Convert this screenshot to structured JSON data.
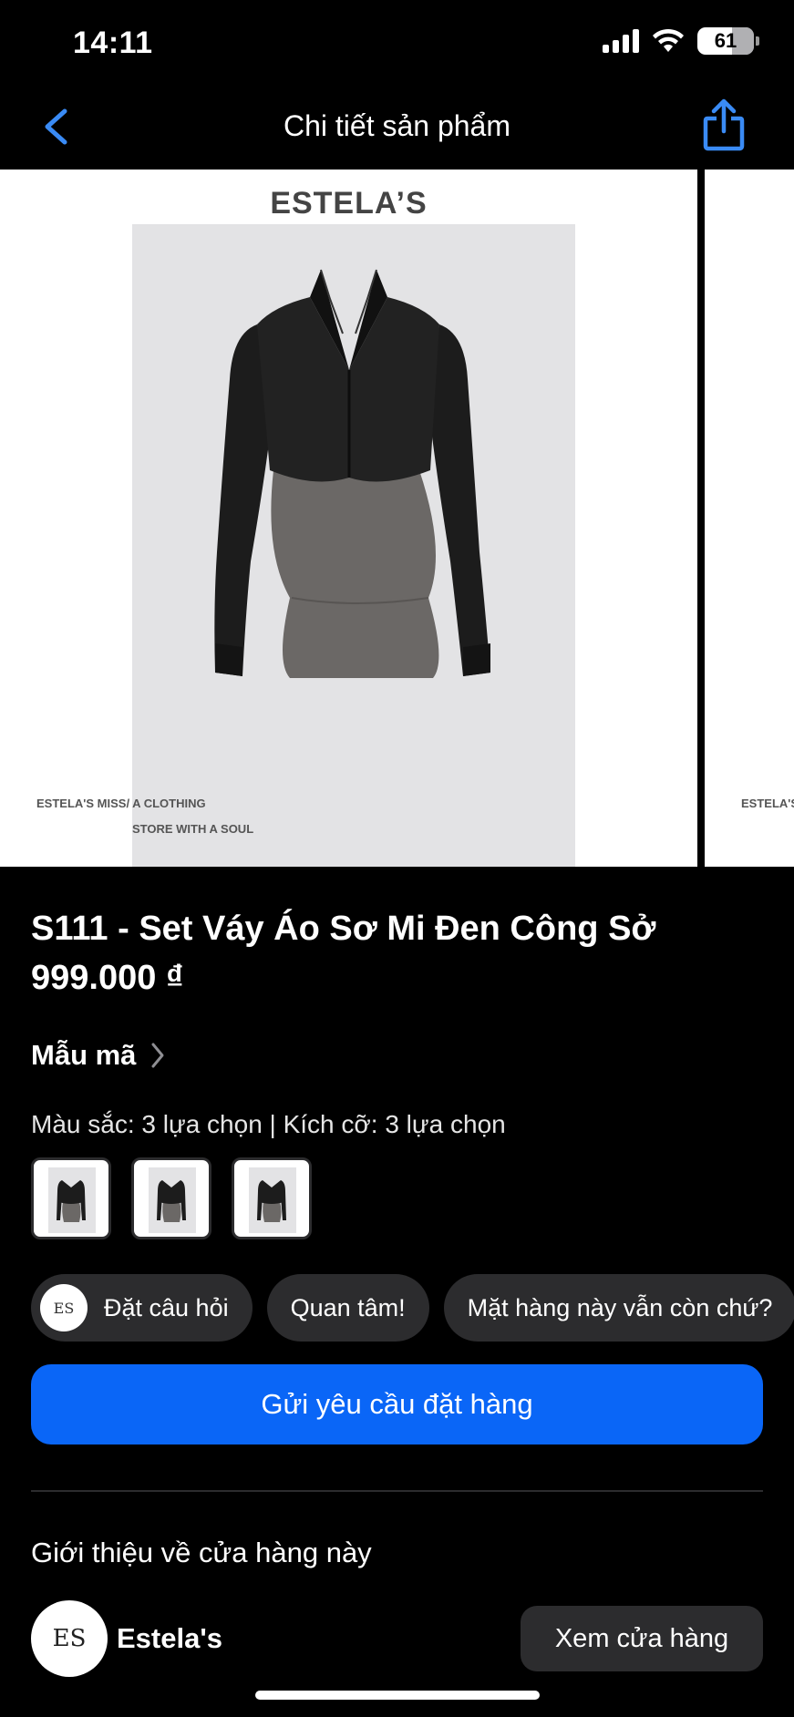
{
  "status_bar": {
    "time": "14:11",
    "battery": "61"
  },
  "nav": {
    "title": "Chi tiết sản phẩm",
    "back_icon": "chevron-left-icon",
    "share_icon": "share-icon",
    "accent_color": "#3a8bf5"
  },
  "product_image": {
    "brand": "ESTELA’S",
    "caption_line1": "ESTELA'S MISS/ A CLOTHING",
    "caption_line2": "STORE WITH A SOUL",
    "next_slide_caption": "ESTELA'S"
  },
  "product": {
    "title": "S111 - Set Váy Áo Sơ Mi Đen Công Sở",
    "price": "999.000 ₫"
  },
  "variants": {
    "title": "Mẫu mã",
    "summary": "Màu sắc: 3 lựa chọn | Kích cỡ: 3 lựa chọn",
    "thumbnail_count": 3
  },
  "quick_replies": [
    {
      "label": "Đặt câu hỏi"
    },
    {
      "label": "Quan tâm!"
    },
    {
      "label": "Mặt hàng này vẫn còn chứ?"
    }
  ],
  "order_button": {
    "label": "Gửi yêu cầu đặt hàng",
    "color": "#0a66f7"
  },
  "shop": {
    "section_title": "Giới thiệu về cửa hàng này",
    "avatar_monogram": "ES",
    "name": "Estela's",
    "visit_label": "Xem cửa hàng"
  }
}
